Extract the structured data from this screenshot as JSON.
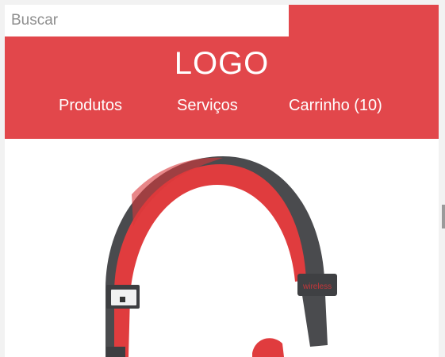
{
  "search": {
    "placeholder": "Buscar",
    "value": ""
  },
  "header": {
    "logo": "LOGO",
    "background_color": "#e2474b"
  },
  "nav": {
    "items": [
      {
        "label": "Produtos"
      },
      {
        "label": "Serviços"
      },
      {
        "label": "Carrinho (10)"
      }
    ]
  },
  "product": {
    "image_icon": "headphones-icon",
    "headphone_text": "wireless"
  },
  "colors": {
    "accent": "#e2474b",
    "headband_dark": "#4a4b4e",
    "headband_red": "#e03c3e"
  }
}
